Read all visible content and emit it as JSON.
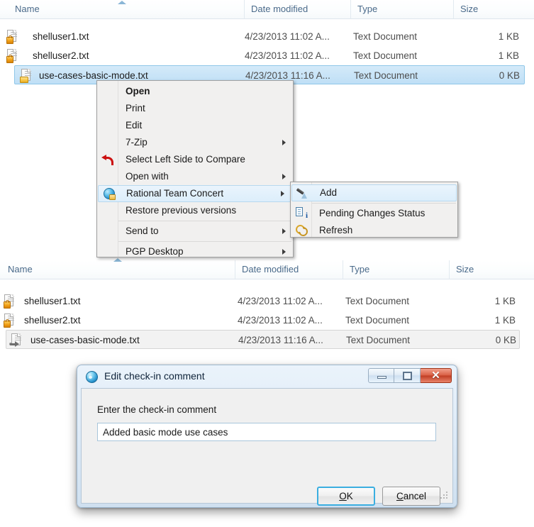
{
  "explorer": {
    "columns": [
      {
        "label": "Name"
      },
      {
        "label": "Date modified"
      },
      {
        "label": "Type"
      },
      {
        "label": "Size"
      }
    ],
    "sort_indicator_icon": "sort-ascending-arrow-icon",
    "top_pane": {
      "rows": [
        {
          "name": "shelluser1.txt",
          "date": "4/23/2013 11:02 A...",
          "type": "Text Document",
          "size": "1 KB",
          "icon": "text-document-locked-icon",
          "state": "normal"
        },
        {
          "name": "shelluser2.txt",
          "date": "4/23/2013 11:02 A...",
          "type": "Text Document",
          "size": "1 KB",
          "icon": "text-document-locked-icon",
          "state": "normal"
        },
        {
          "name": "use-cases-basic-mode.txt",
          "date": "4/23/2013 11:16 A...",
          "type": "Text Document",
          "size": "0 KB",
          "icon": "text-document-unlocked-icon",
          "state": "selected"
        }
      ]
    },
    "bottom_pane": {
      "rows": [
        {
          "name": "shelluser1.txt",
          "date": "4/23/2013 11:02 A...",
          "type": "Text Document",
          "size": "1 KB",
          "icon": "text-document-locked-icon",
          "state": "normal"
        },
        {
          "name": "shelluser2.txt",
          "date": "4/23/2013 11:02 A...",
          "type": "Text Document",
          "size": "1 KB",
          "icon": "text-document-locked-icon",
          "state": "normal"
        },
        {
          "name": "use-cases-basic-mode.txt",
          "date": "4/23/2013 11:16 A...",
          "type": "Text Document",
          "size": "0 KB",
          "icon": "text-document-pending-add-icon",
          "state": "selected-inactive"
        }
      ]
    }
  },
  "context_menu": {
    "items": [
      {
        "label": "Open",
        "bold": true,
        "submenu": false,
        "icon": null
      },
      {
        "label": "Print",
        "bold": false,
        "submenu": false,
        "icon": null
      },
      {
        "label": "Edit",
        "bold": false,
        "submenu": false,
        "icon": null
      },
      {
        "label": "7-Zip",
        "bold": false,
        "submenu": true,
        "icon": null
      },
      {
        "label": "Select Left Side to Compare",
        "bold": false,
        "submenu": false,
        "icon": "red-undo-arrow-icon"
      },
      {
        "label": "Open with",
        "bold": false,
        "submenu": true,
        "icon": null
      },
      {
        "label": "Rational Team Concert",
        "bold": false,
        "submenu": true,
        "icon": "rtc-globe-icon",
        "highlighted": true
      },
      {
        "label": "Restore previous versions",
        "bold": false,
        "submenu": false,
        "icon": null
      },
      {
        "label": "Send to",
        "bold": false,
        "submenu": true,
        "icon": null
      },
      {
        "label": "PGP Desktop",
        "bold": false,
        "submenu": true,
        "icon": null
      }
    ]
  },
  "submenu": {
    "items": [
      {
        "label": "Add",
        "icon": "add-pen-icon",
        "highlighted": true
      },
      {
        "label": "Pending Changes Status",
        "icon": "pending-changes-info-icon",
        "highlighted": false
      },
      {
        "label": "Refresh",
        "icon": "refresh-arrows-icon",
        "highlighted": false
      }
    ]
  },
  "dialog": {
    "title": "Edit check-in comment",
    "title_icon": "rtc-sphere-icon",
    "window_buttons": {
      "minimize": "minimize-icon",
      "maximize": "maximize-icon",
      "close_glyph": "✕"
    },
    "prompt": "Enter the check-in comment",
    "input_value": "Added basic mode use cases",
    "input_placeholder": "",
    "ok_prefix": "",
    "ok_accel": "O",
    "ok_suffix": "K",
    "cancel_prefix": "",
    "cancel_accel": "C",
    "cancel_suffix": "ancel"
  },
  "colors": {
    "selection_blue": "#bfdff6",
    "selection_border": "#8fc7e8",
    "header_text": "#4a6a8a",
    "close_button_red": "#c03d23",
    "focus_blue": "#3aaee0"
  }
}
